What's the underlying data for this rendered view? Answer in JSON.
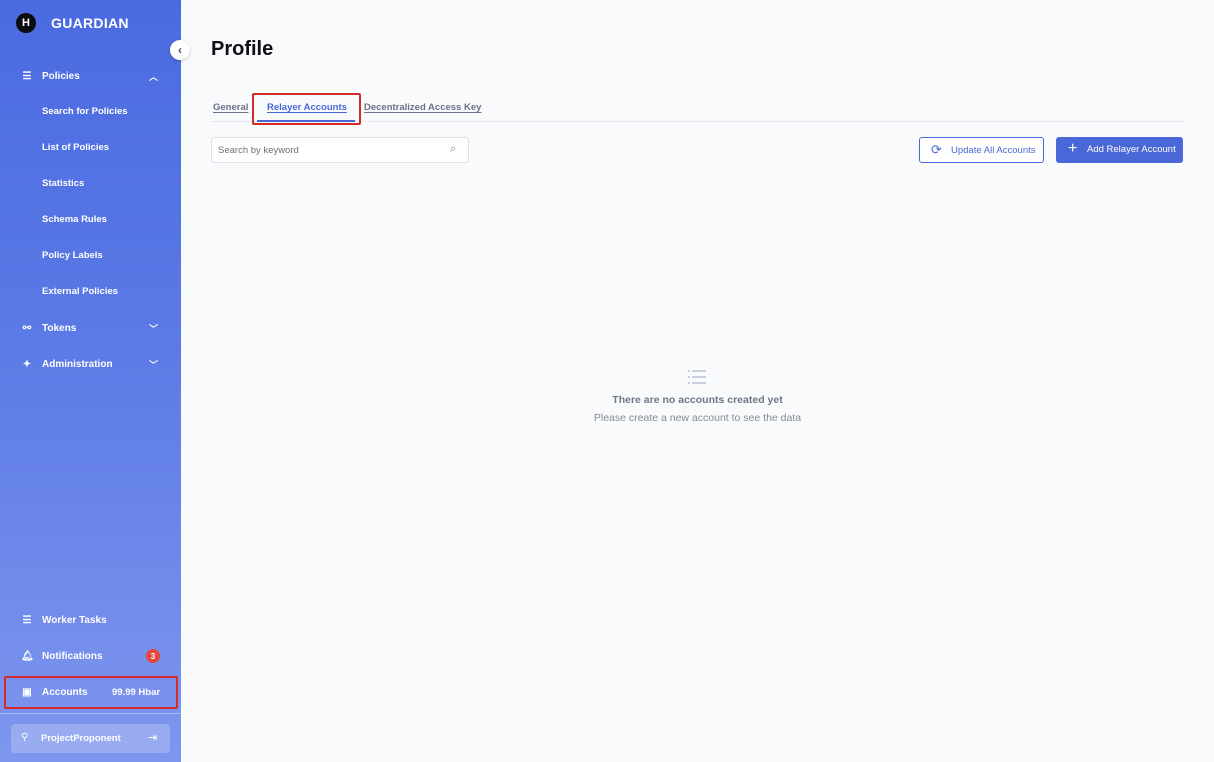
{
  "app": {
    "brand_initial": "H",
    "brand_name": "GUARDIAN",
    "accent_color": "#4a67d8",
    "highlight_color": "#d12b2b"
  },
  "sidebar": {
    "collapse_icon": "chevron-left-icon",
    "policies": {
      "label": "Policies",
      "icon": "list-icon",
      "chevron": "chevron-up-icon",
      "sub_items": [
        "Search for Policies",
        "List of Policies",
        "Statistics",
        "Schema Rules",
        "Policy Labels",
        "External Policies"
      ]
    },
    "tokens": {
      "label": "Tokens",
      "icon": "link-icon",
      "chevron": "chevron-down-icon"
    },
    "administration": {
      "label": "Administration",
      "icon": "sparkle-icon",
      "chevron": "chevron-down-icon"
    },
    "worker_tasks": {
      "label": "Worker Tasks",
      "icon": "list-icon"
    },
    "notifications": {
      "label": "Notifications",
      "icon": "bell-icon",
      "badge": "3"
    },
    "accounts": {
      "label": "Accounts",
      "icon": "wallet-icon",
      "value": "99.99 Hbar"
    },
    "user": {
      "label": "ProjectProponent",
      "icon": "user-icon",
      "logout_icon": "logout-icon"
    }
  },
  "main": {
    "title": "Profile",
    "tabs": [
      {
        "label": "General",
        "active": false
      },
      {
        "label": "Relayer Accounts",
        "active": true
      },
      {
        "label": "Decentralized Access Key",
        "active": false
      }
    ],
    "search": {
      "placeholder": "Search by keyword",
      "value": "",
      "icon": "search-icon"
    },
    "update_button": {
      "label": "Update All Accounts",
      "icon": "refresh-icon"
    },
    "add_button": {
      "label": "Add Relayer Account",
      "icon": "plus-icon"
    },
    "empty_state": {
      "icon": "list-icon",
      "title": "There are no accounts created yet",
      "subtitle": "Please create a new account to see the data"
    }
  }
}
